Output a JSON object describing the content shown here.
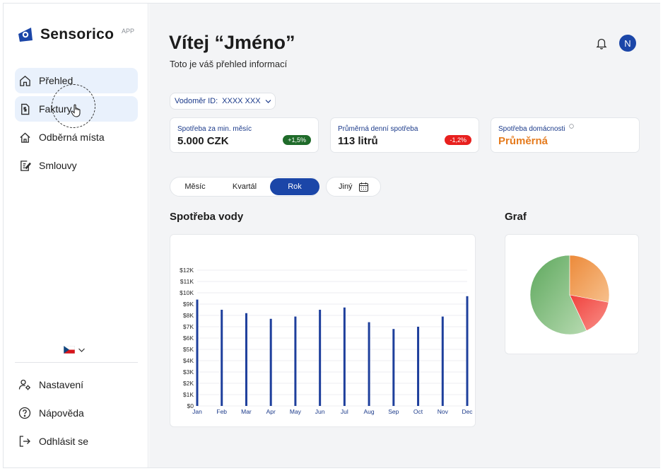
{
  "app": {
    "name": "Sensorico",
    "badge": "APP"
  },
  "sidebar": {
    "items": [
      {
        "label": "Přehled",
        "icon": "home-icon"
      },
      {
        "label": "Faktury",
        "icon": "invoice-icon"
      },
      {
        "label": "Odběrná místa",
        "icon": "house-icon"
      },
      {
        "label": "Smlouvy",
        "icon": "contract-icon"
      }
    ],
    "language": {
      "icon": "czech-flag-icon"
    },
    "bottom_items": [
      {
        "label": "Nastavení",
        "icon": "user-settings-icon"
      },
      {
        "label": "Nápověda",
        "icon": "help-icon"
      },
      {
        "label": "Odhlásit se",
        "icon": "logout-icon"
      }
    ]
  },
  "header": {
    "title": "Vítej “Jméno”",
    "subtitle": "Toto je váš přehled informací",
    "avatar_initial": "N"
  },
  "meter": {
    "label": "Vodoměr ID:",
    "value": "XXXX XXX"
  },
  "stats": [
    {
      "label": "Spotřeba za min. měsíc",
      "value": "5.000 CZK",
      "badge": "+1,5%",
      "badge_color": "#1f6b2a"
    },
    {
      "label": "Průměrná denní spotřeba",
      "value": "113 litrů",
      "badge": "-1,2%",
      "badge_color": "#e8201e"
    },
    {
      "label": "Spotřeba domácnosti",
      "value": "Průměrná",
      "value_color": "#e57b1e"
    }
  ],
  "period_tabs": {
    "items": [
      "Měsíc",
      "Kvartál",
      "Rok"
    ],
    "active": "Rok",
    "other": "Jiný"
  },
  "sections": {
    "consumption_title": "Spotřeba vody",
    "graph_title": "Graf"
  },
  "colors": {
    "accent": "#1b46a8",
    "bar": "#1e3f9c"
  },
  "chart_data": [
    {
      "type": "bar",
      "categories": [
        "Jan",
        "Feb",
        "Mar",
        "Apr",
        "May",
        "Jun",
        "Jul",
        "Aug",
        "Sep",
        "Oct",
        "Nov",
        "Dec"
      ],
      "values": [
        9400,
        8500,
        8200,
        7700,
        7900,
        8500,
        8700,
        7400,
        6800,
        7000,
        7900,
        9700
      ],
      "ylim": [
        0,
        12000
      ],
      "yticks": [
        0,
        1000,
        2000,
        3000,
        4000,
        5000,
        6000,
        7000,
        8000,
        9000,
        10000,
        11000,
        12000
      ],
      "ytick_labels": [
        "$0",
        "$1K",
        "$2K",
        "$3K",
        "$4K",
        "$5K",
        "$6K",
        "$7K",
        "$8K",
        "$9K",
        "$10K",
        "$11K",
        "$12K"
      ],
      "grid": true
    },
    {
      "type": "pie",
      "values": [
        57,
        28,
        15
      ],
      "colors": [
        "#6bb36a",
        "#f09a4b",
        "#ef5a50"
      ]
    }
  ]
}
